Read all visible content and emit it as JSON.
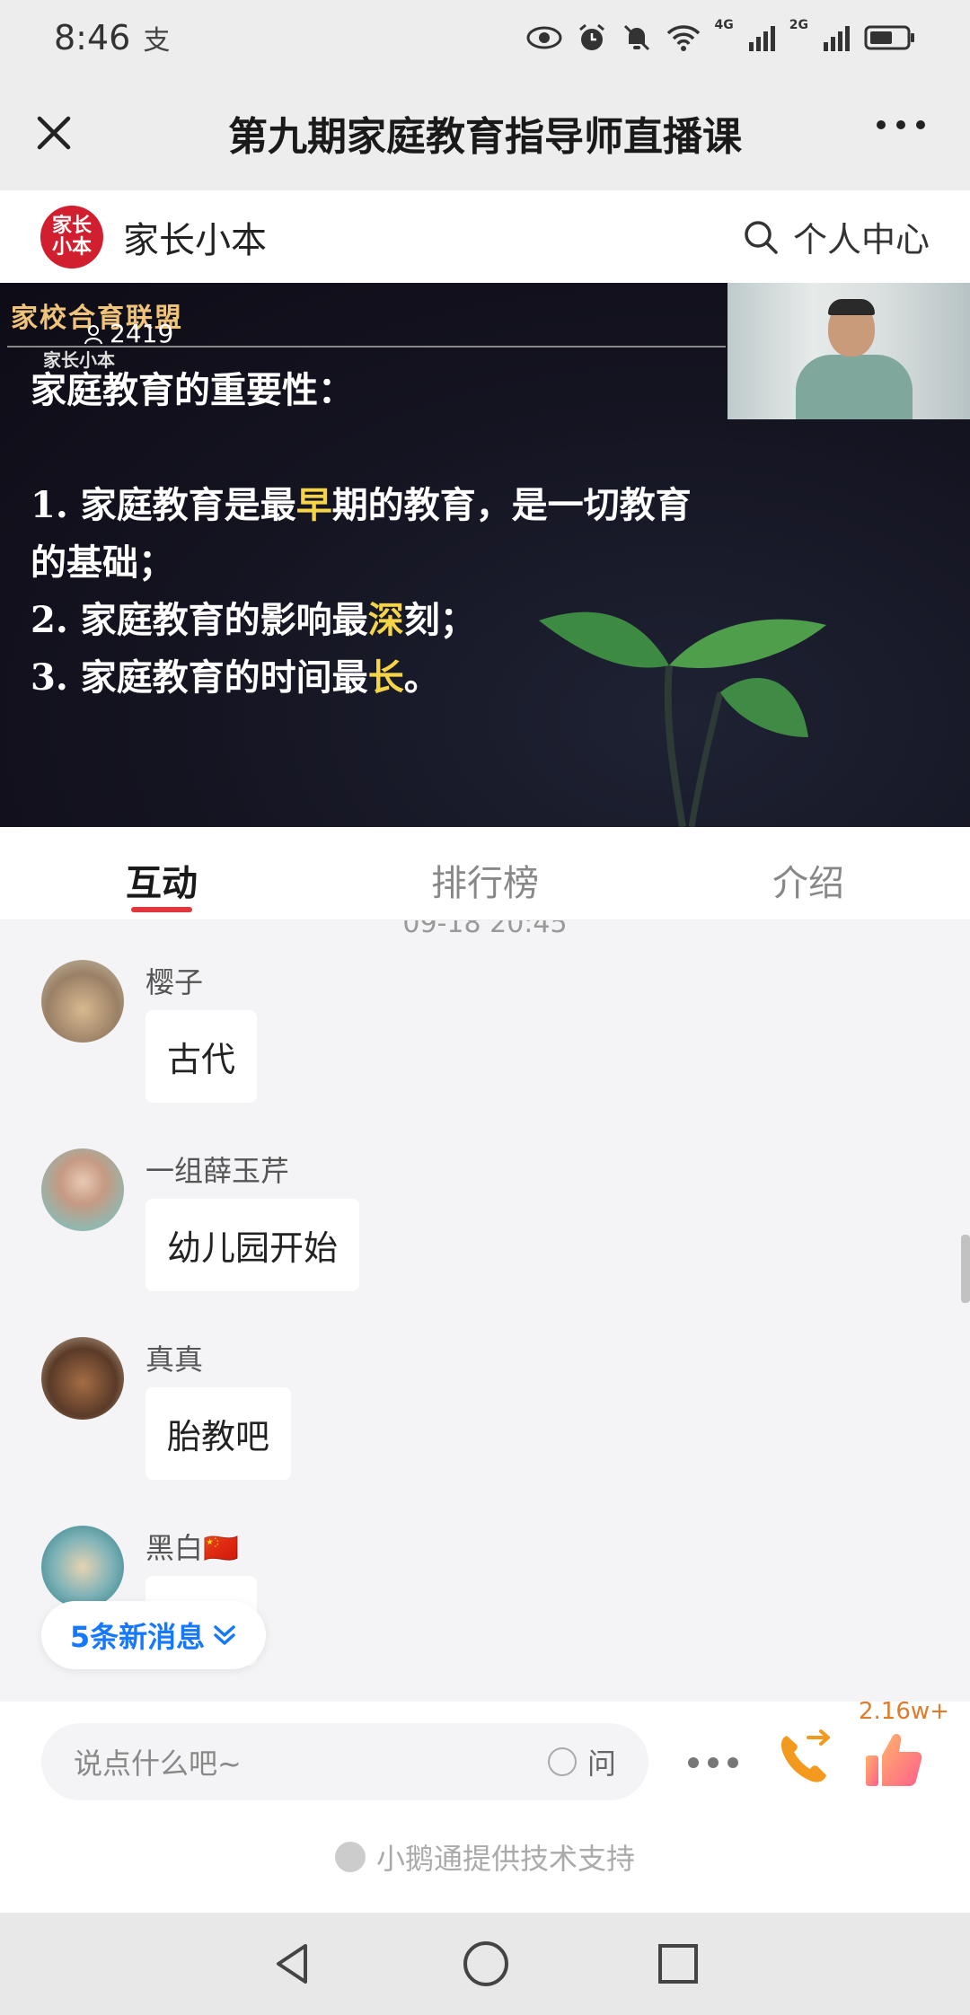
{
  "status_bar": {
    "time": "8:46",
    "alipay_glyph": "支",
    "net1": "4G",
    "net2": "2G"
  },
  "title_bar": {
    "title": "第九期家庭教育指导师直播课"
  },
  "app_header": {
    "logo_text_1": "家长",
    "logo_text_2": "小本",
    "name": "家长小本",
    "personal_center": "个人中心"
  },
  "video": {
    "brand": "家校合育联盟",
    "brand_sub": "家长小本",
    "viewer_count": "2419",
    "slide": {
      "heading": "家庭教育的重要性：",
      "line1_a": "1. 家庭教育是最",
      "line1_hl": "早",
      "line1_b": "期的教育，是一切教育",
      "line1_c": "的基础；",
      "line2_a": "2. 家庭教育的影响最",
      "line2_hl": "深",
      "line2_b": "刻；",
      "line3_a": "3. 家庭教育的时间最",
      "line3_hl": "长",
      "line3_b": "。"
    }
  },
  "tabs": [
    {
      "label": "互动"
    },
    {
      "label": "排行榜"
    },
    {
      "label": "介绍"
    }
  ],
  "chat": {
    "timestamp": "09-18 20:45",
    "messages": [
      {
        "name": "樱子",
        "text": "古代"
      },
      {
        "name": "一组薛玉芹",
        "text": "幼儿园开始"
      },
      {
        "name": "真真",
        "text": "胎教吧"
      },
      {
        "name": "黑白🇨🇳",
        "text": ""
      }
    ],
    "new_messages": "5条新消息"
  },
  "input_bar": {
    "placeholder": "说点什么吧~",
    "ask_label": "问",
    "like_count": "2.16w+"
  },
  "footer": {
    "text": "小鹅通提供技术支持"
  },
  "colors": {
    "accent": "#e2363c",
    "link_blue": "#1677ff",
    "like_orange": "#e07b2a"
  }
}
